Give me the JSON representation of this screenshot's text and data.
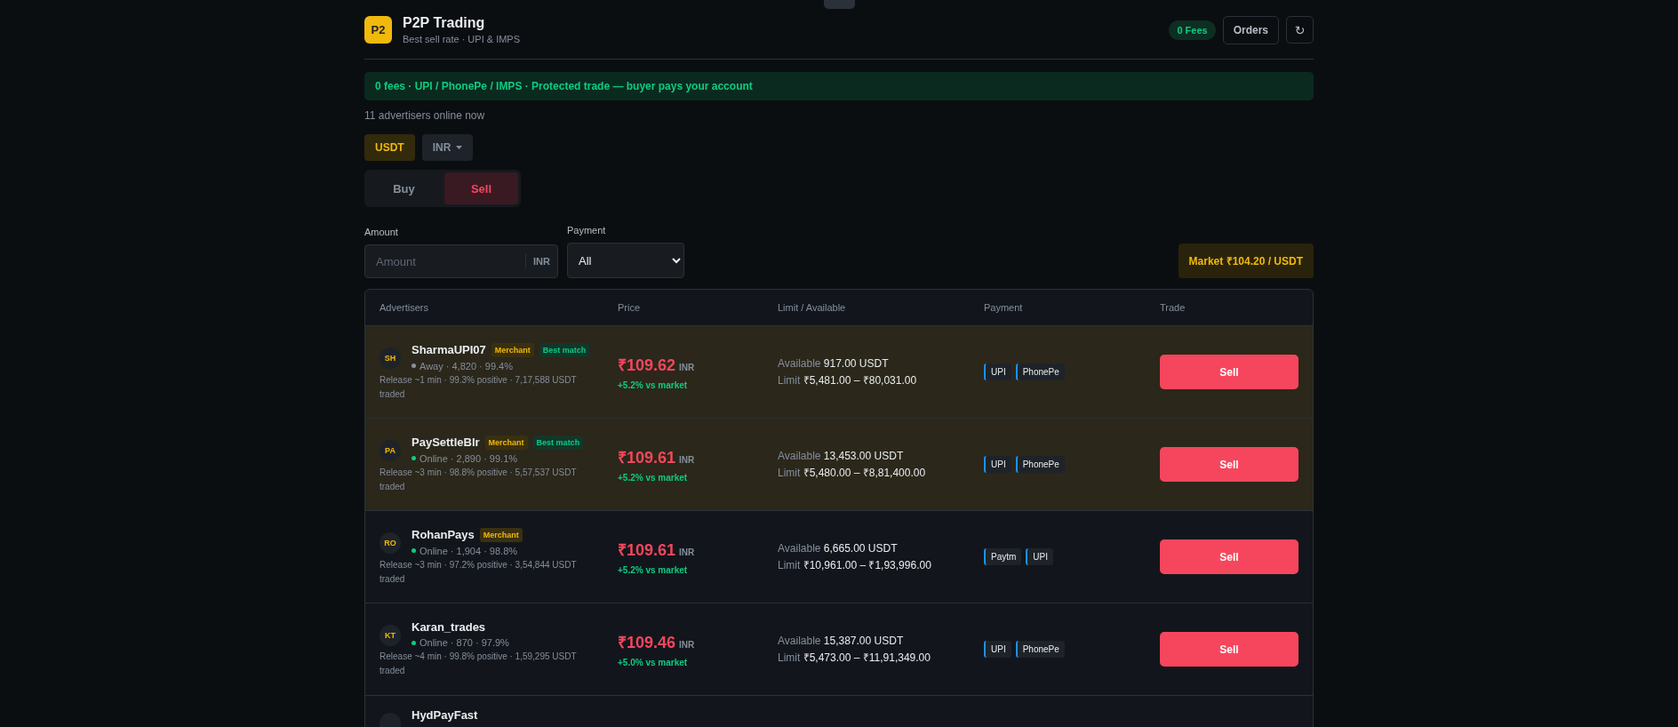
{
  "header": {
    "logo": "P2",
    "title": "P2P Trading",
    "subtitle": "Best sell rate · UPI & IMPS",
    "fees_badge": "0 Fees",
    "orders_button": "Orders",
    "refresh_button": "↻"
  },
  "banner": "0 fees · UPI / PhonePe / IMPS · Protected trade — buyer pays your account",
  "online_count": "11 advertisers online now",
  "asset_chips": [
    {
      "label": "USDT",
      "kind": "chip",
      "selected": true
    },
    {
      "label": "INR",
      "kind": "dropdown",
      "selected": false
    }
  ],
  "side_tabs": [
    {
      "label": "Buy",
      "selected": false
    },
    {
      "label": "Sell",
      "selected": true
    }
  ],
  "filters": {
    "amount_label": "Amount",
    "amount_placeholder": "Amount",
    "amount_unit": "INR",
    "payment_label": "Payment",
    "payment_value": "All",
    "market": "Market ₹104.20 / USDT"
  },
  "table": {
    "columns": [
      "Advertisers",
      "Price",
      "Limit / Available",
      "Payment",
      "Trade"
    ],
    "rows": [
      {
        "initials": "SH",
        "name": "SharmaUPI07",
        "badges": [
          {
            "label": "Merchant",
            "kind": "merchant"
          },
          {
            "label": "Best match",
            "kind": "best"
          }
        ],
        "status": "Away · 4,820 · 99.4%",
        "color": "#8b919c",
        "release": "Release ~1 min · 99.3% positive · 7,17,588 USDT traded",
        "price": "₹109.62",
        "price_unit": "INR",
        "vs_market": "+5.2% vs market",
        "available_label": "Available",
        "available": "917.00 USDT",
        "limit_label": "Limit",
        "limit": "₹5,481.00 – ₹80,031.00",
        "payments": [
          "UPI",
          "PhonePe"
        ],
        "action": "Sell",
        "highlighted": true
      },
      {
        "initials": "PA",
        "name": "PaySettleBlr",
        "badges": [
          {
            "label": "Merchant",
            "kind": "merchant"
          },
          {
            "label": "Best match",
            "kind": "best"
          }
        ],
        "status": "Online · 2,890 · 99.1%",
        "color": "#0ecb81",
        "release": "Release ~3 min · 98.8% positive · 5,57,537 USDT traded",
        "price": "₹109.61",
        "price_unit": "INR",
        "vs_market": "+5.2% vs market",
        "available_label": "Available",
        "available": "13,453.00 USDT",
        "limit_label": "Limit",
        "limit": "₹5,480.00 – ₹8,81,400.00",
        "payments": [
          "UPI",
          "PhonePe"
        ],
        "action": "Sell",
        "highlighted": true
      },
      {
        "initials": "RO",
        "name": "RohanPays",
        "badges": [
          {
            "label": "Merchant",
            "kind": "merchant"
          }
        ],
        "status": "Online · 1,904 · 98.8%",
        "color": "#0ecb81",
        "release": "Release ~3 min · 97.2% positive · 3,54,844 USDT traded",
        "price": "₹109.61",
        "price_unit": "INR",
        "vs_market": "+5.2% vs market",
        "available_label": "Available",
        "available": "6,665.00 USDT",
        "limit_label": "Limit",
        "limit": "₹10,961.00 – ₹1,93,996.00",
        "payments": [
          "Paytm",
          "UPI"
        ],
        "action": "Sell",
        "highlighted": false
      },
      {
        "initials": "KT",
        "name": "Karan_trades",
        "badges": [],
        "status": "Online · 870 · 97.9%",
        "color": "#0ecb81",
        "release": "Release ~4 min · 99.8% positive · 1,59,295 USDT traded",
        "price": "₹109.46",
        "price_unit": "INR",
        "vs_market": "+5.0% vs market",
        "available_label": "Available",
        "available": "15,387.00 USDT",
        "limit_label": "Limit",
        "limit": "₹5,473.00 – ₹11,91,349.00",
        "payments": [
          "UPI",
          "PhonePe"
        ],
        "action": "Sell",
        "highlighted": false
      },
      {
        "name": "HydPayFast",
        "highlighted": false
      }
    ]
  }
}
